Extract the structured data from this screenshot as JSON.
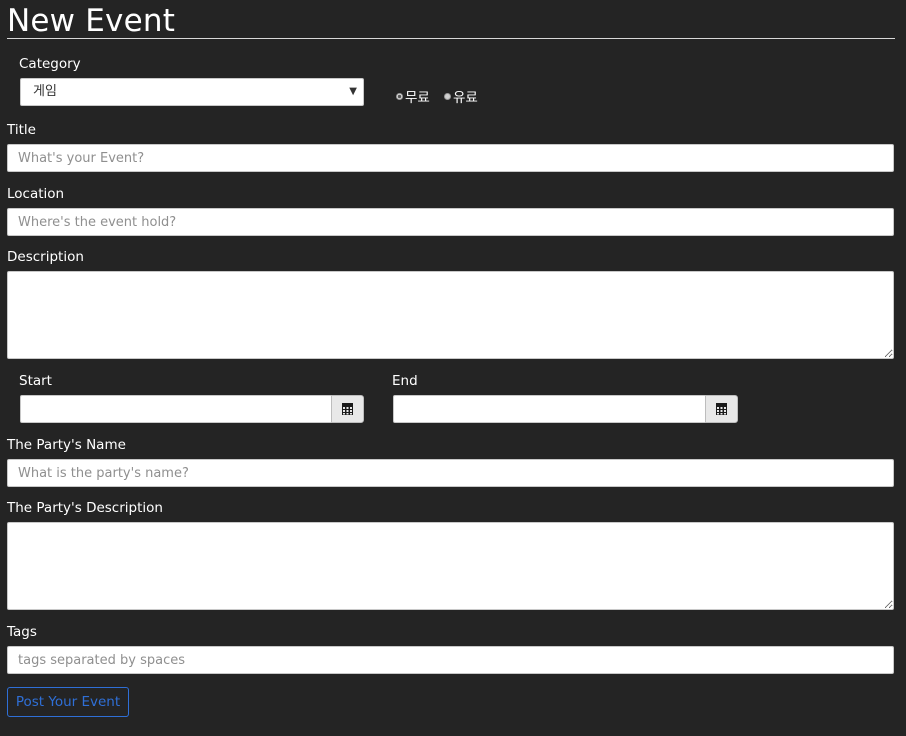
{
  "page": {
    "title": "New Event"
  },
  "category": {
    "label": "Category",
    "selected": "게임"
  },
  "fee": {
    "options": [
      {
        "label": "무료",
        "checked": true
      },
      {
        "label": "유료",
        "checked": false
      }
    ]
  },
  "title_field": {
    "label": "Title",
    "placeholder": "What's your Event?"
  },
  "location_field": {
    "label": "Location",
    "placeholder": "Where's the event hold?"
  },
  "description_field": {
    "label": "Description"
  },
  "start_field": {
    "label": "Start"
  },
  "end_field": {
    "label": "End"
  },
  "party_name_field": {
    "label": "The Party's Name",
    "placeholder": "What is the party's name?"
  },
  "party_description_field": {
    "label": "The Party's Description"
  },
  "tags_field": {
    "label": "Tags",
    "placeholder": "tags separated by spaces"
  },
  "submit": {
    "label": "Post Your Event"
  },
  "icons": {
    "calendar": "calendar-icon",
    "dropdown": "chevron-down-icon"
  },
  "colors": {
    "background": "#242424",
    "accent": "#2f6fd6"
  }
}
